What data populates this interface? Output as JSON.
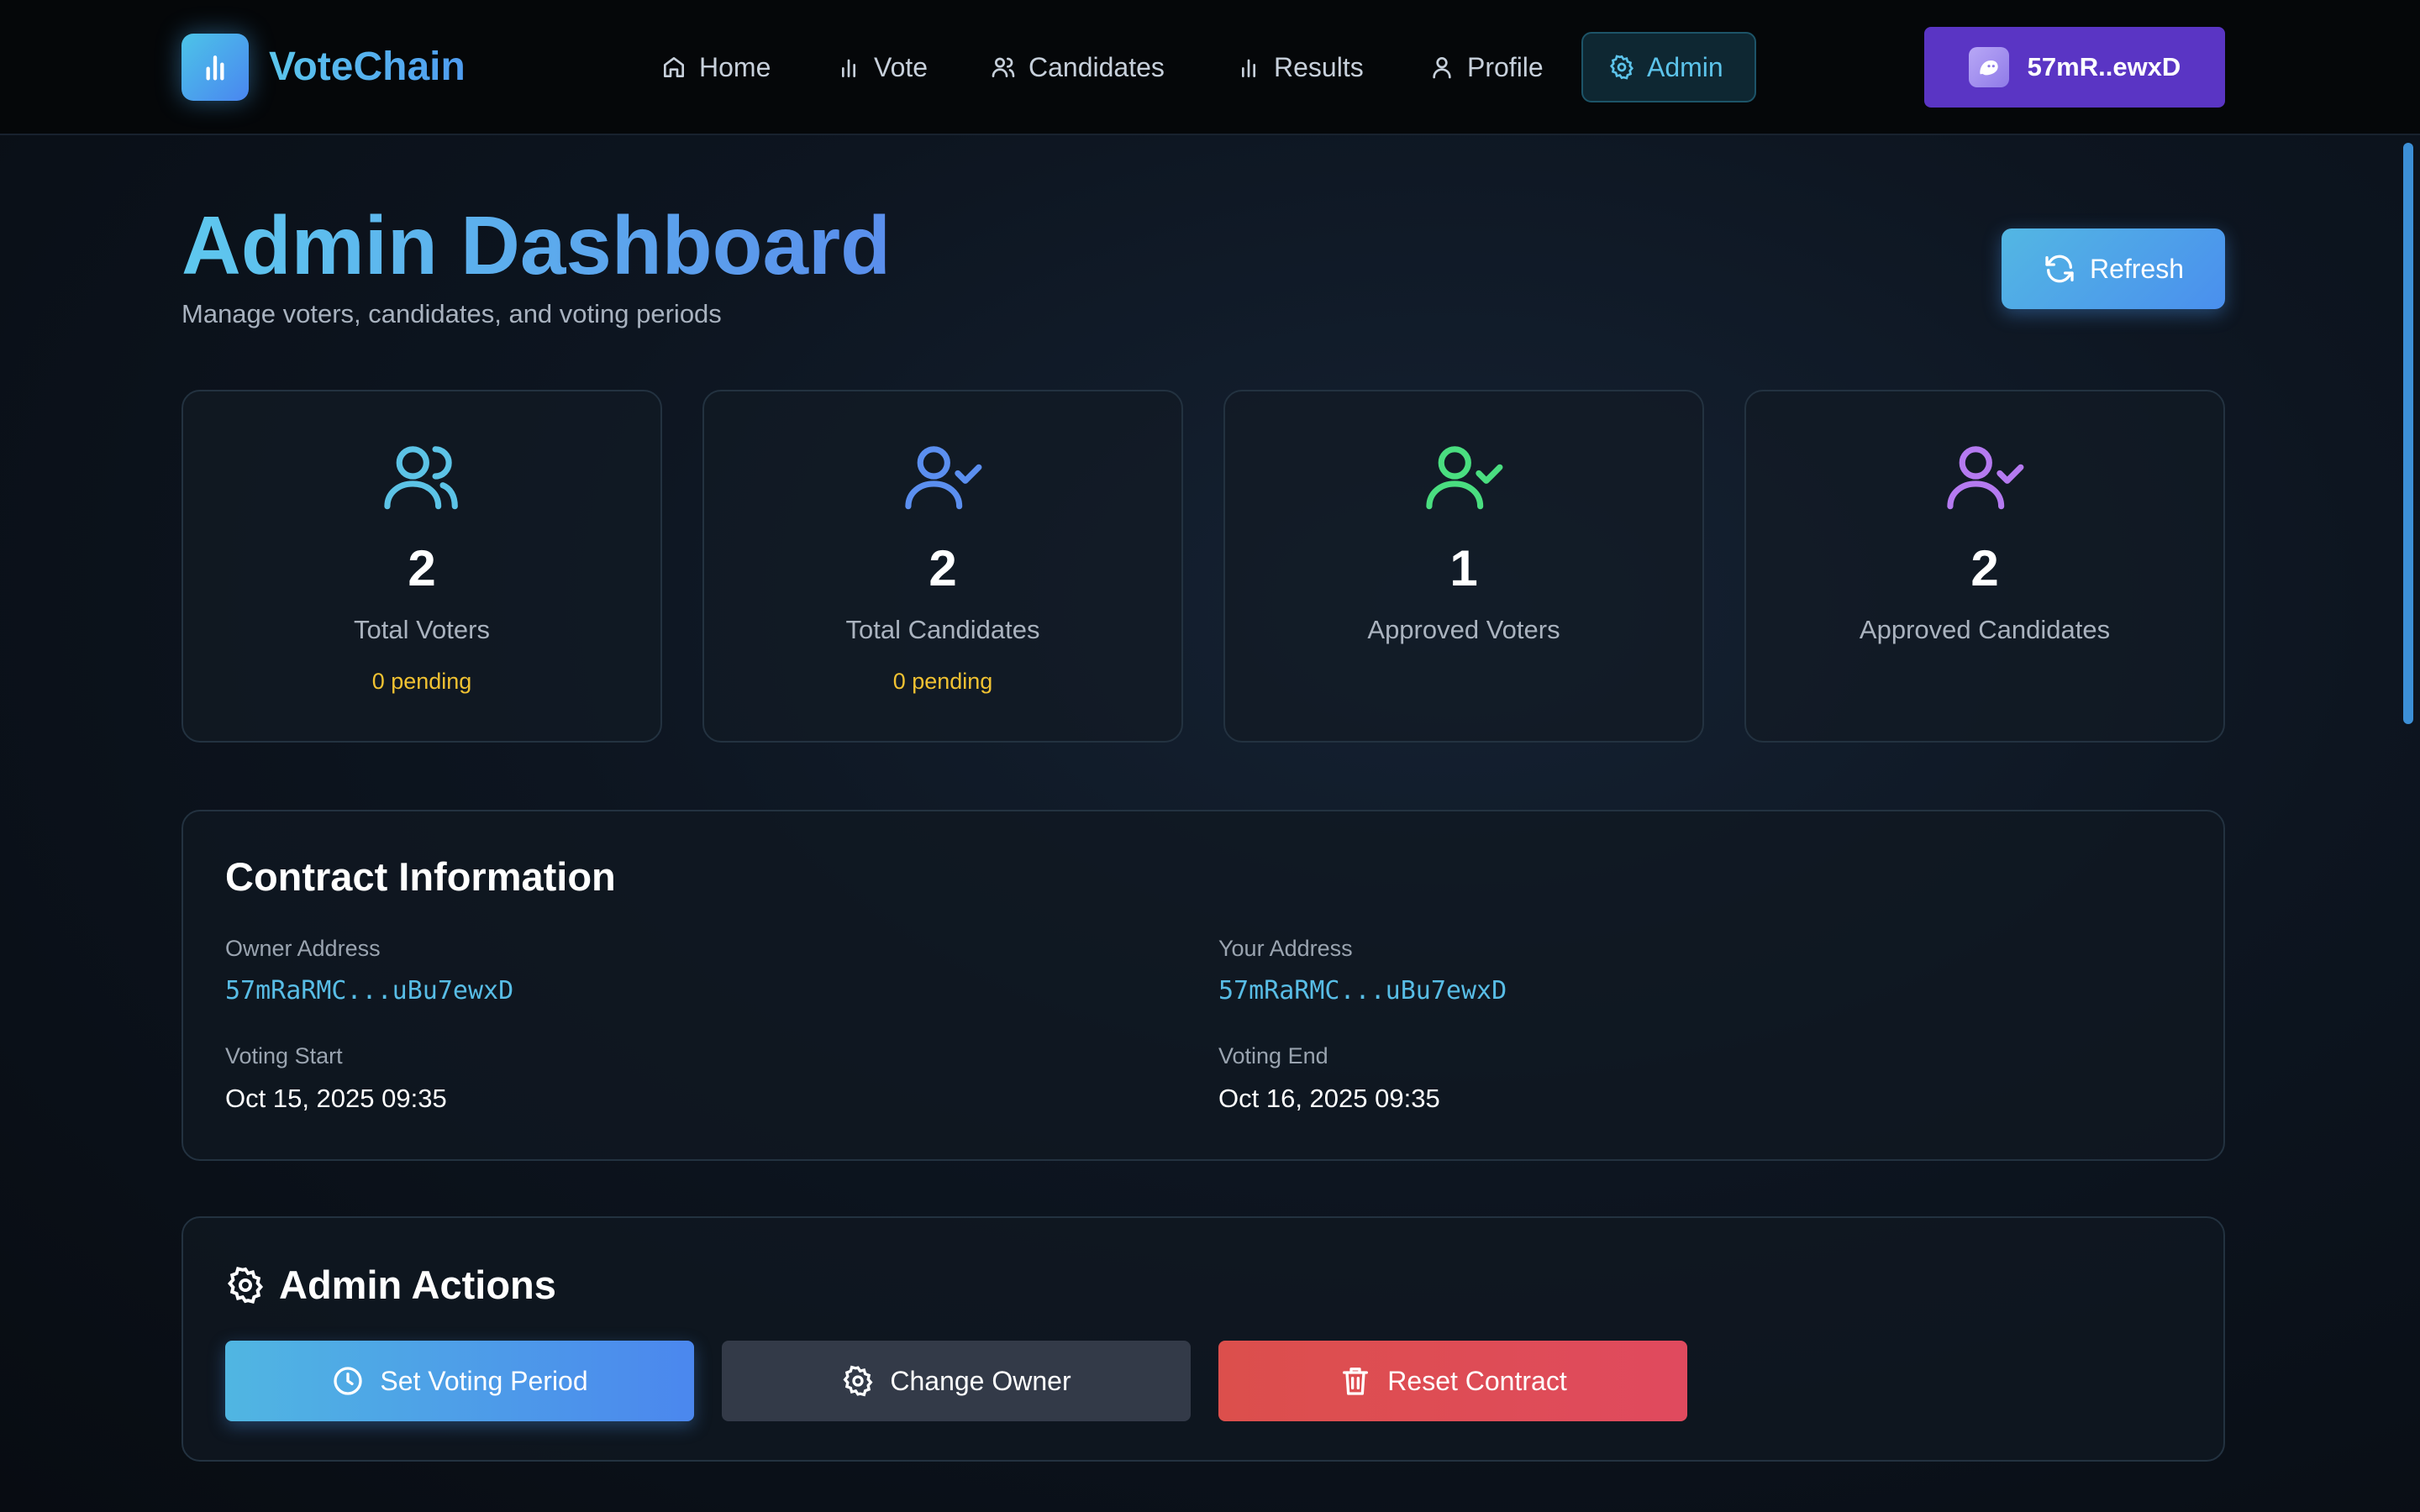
{
  "app": {
    "name": "VoteChain"
  },
  "nav": {
    "items": [
      {
        "label": "Home",
        "icon": "home-icon"
      },
      {
        "label": "Vote",
        "icon": "bar-chart-icon"
      },
      {
        "label": "Candidates",
        "icon": "users-icon"
      },
      {
        "label": "Results",
        "icon": "bar-chart-icon"
      },
      {
        "label": "Profile",
        "icon": "user-icon"
      },
      {
        "label": "Admin",
        "icon": "gear-icon",
        "active": true
      }
    ],
    "wallet_label": "57mR..ewxD"
  },
  "header": {
    "title": "Admin Dashboard",
    "subtitle": "Manage voters, candidates, and voting periods",
    "refresh_label": "Refresh"
  },
  "stats": [
    {
      "value": "2",
      "label": "Total Voters",
      "pending": "0 pending",
      "icon": "users-icon",
      "color": "#5cc3e6"
    },
    {
      "value": "2",
      "label": "Total Candidates",
      "pending": "0 pending",
      "icon": "user-check-icon",
      "color": "#5b8ff0"
    },
    {
      "value": "1",
      "label": "Approved Voters",
      "icon": "user-check-icon",
      "color": "#4ade80"
    },
    {
      "value": "2",
      "label": "Approved Candidates",
      "icon": "user-check-icon",
      "color": "#b57af0"
    }
  ],
  "contract_info": {
    "title": "Contract Information",
    "owner_label": "Owner Address",
    "owner_value": "57mRaRMC...uBu7ewxD",
    "your_label": "Your Address",
    "your_value": "57mRaRMC...uBu7ewxD",
    "start_label": "Voting Start",
    "start_value": "Oct 15, 2025 09:35",
    "end_label": "Voting End",
    "end_value": "Oct 16, 2025 09:35"
  },
  "admin_actions": {
    "title": "Admin Actions",
    "set_period_label": "Set Voting Period",
    "change_owner_label": "Change Owner",
    "reset_label": "Reset Contract"
  },
  "colors": {
    "accent": "#4a8fee",
    "wallet": "#5a35c4",
    "danger": "#dc4f4c",
    "pending": "#f1c232"
  }
}
